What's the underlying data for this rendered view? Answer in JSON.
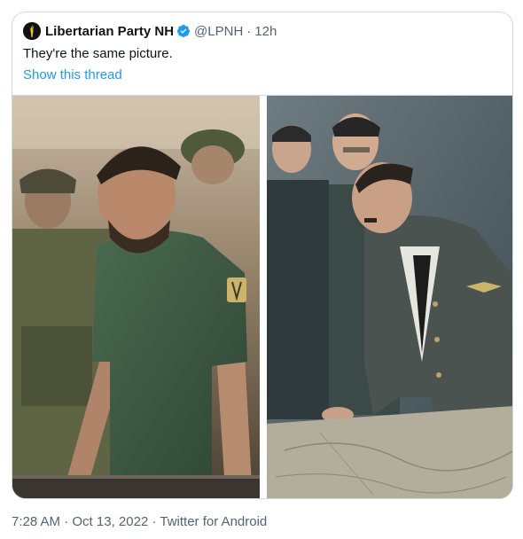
{
  "tweet": {
    "author_name": "Libertarian Party NH",
    "handle": "@LPNH",
    "separator": "·",
    "age": "12h",
    "text": "They're the same picture.",
    "thread_link": "Show this thread"
  },
  "footer": {
    "time": "7:28 AM",
    "separator": "·",
    "date": "Oct 13, 2022",
    "source": "Twitter for Android"
  },
  "colors": {
    "link": "#1d9bf0",
    "secondary_text": "#536471",
    "border": "#cfd9de",
    "verified": "#1d9bf0"
  },
  "icons": {
    "avatar": "torch-logo-icon",
    "verified": "verified-badge-icon"
  }
}
